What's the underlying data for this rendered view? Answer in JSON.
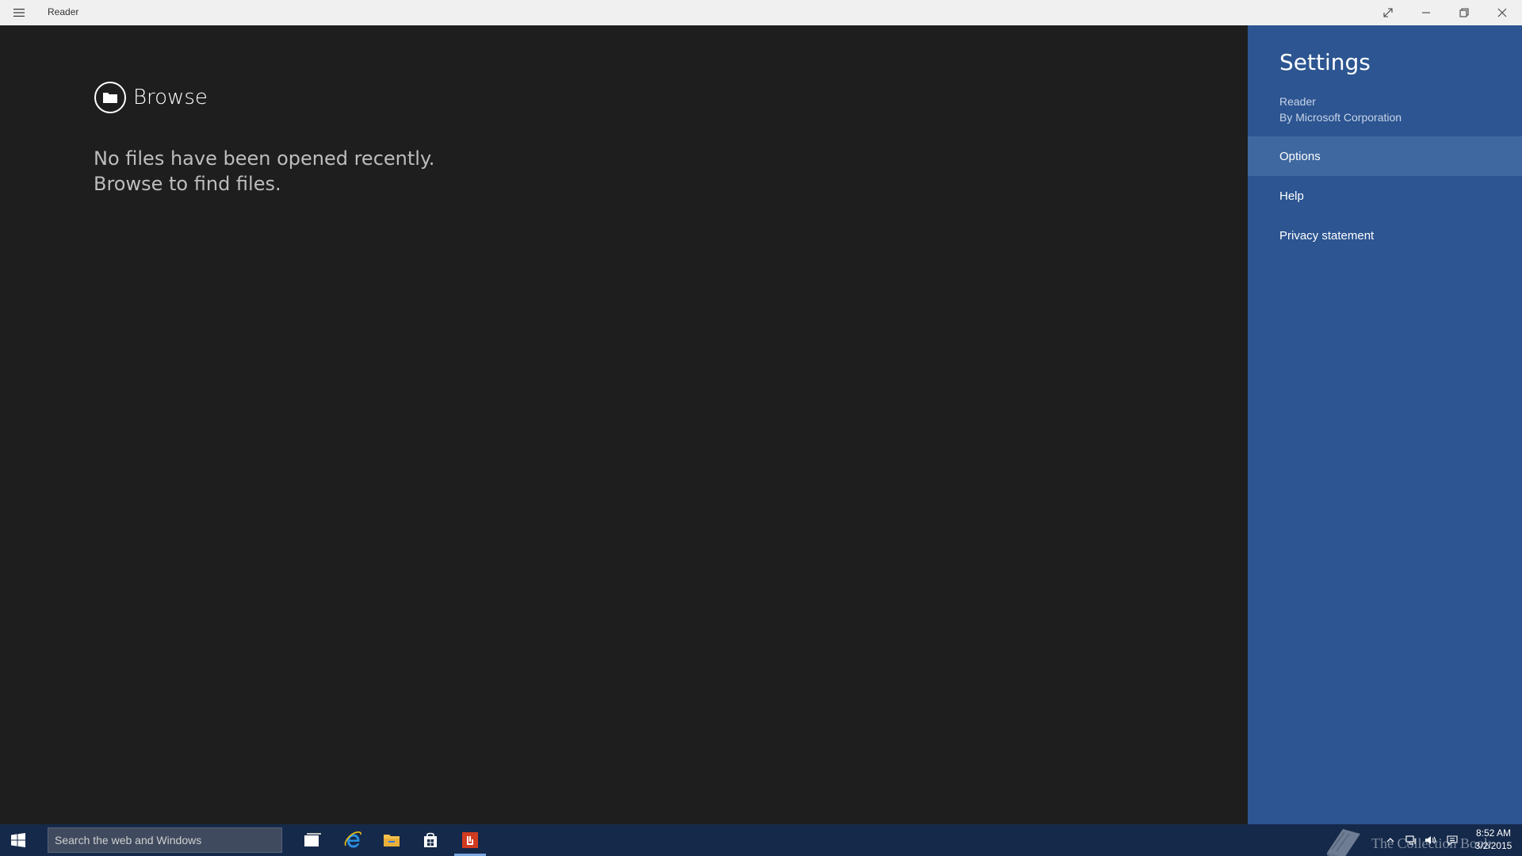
{
  "titlebar": {
    "app_title": "Reader"
  },
  "main": {
    "browse_label": "Browse",
    "empty_line1": "No files have been opened recently.",
    "empty_line2": "Browse to find files."
  },
  "settings": {
    "title": "Settings",
    "app_name": "Reader",
    "publisher": "By Microsoft Corporation",
    "items": [
      {
        "label": "Options",
        "active": true
      },
      {
        "label": "Help",
        "active": false
      },
      {
        "label": "Privacy statement",
        "active": false
      }
    ]
  },
  "taskbar": {
    "search_placeholder": "Search the web and Windows",
    "apps": [
      "task-view-icon",
      "internet-explorer-icon",
      "file-explorer-icon",
      "store-icon",
      "reader-icon"
    ],
    "watermark": "The Collection Book",
    "time": "8:52 AM",
    "date": "3/2/2015"
  },
  "colors": {
    "titlebar_bg": "#f0f0f0",
    "main_bg": "#1e1e1e",
    "settings_bg": "#2c5591",
    "settings_active_bg": "#3e689f",
    "taskbar_bg": "#15294a",
    "reader_accent": "#d13b1f"
  }
}
